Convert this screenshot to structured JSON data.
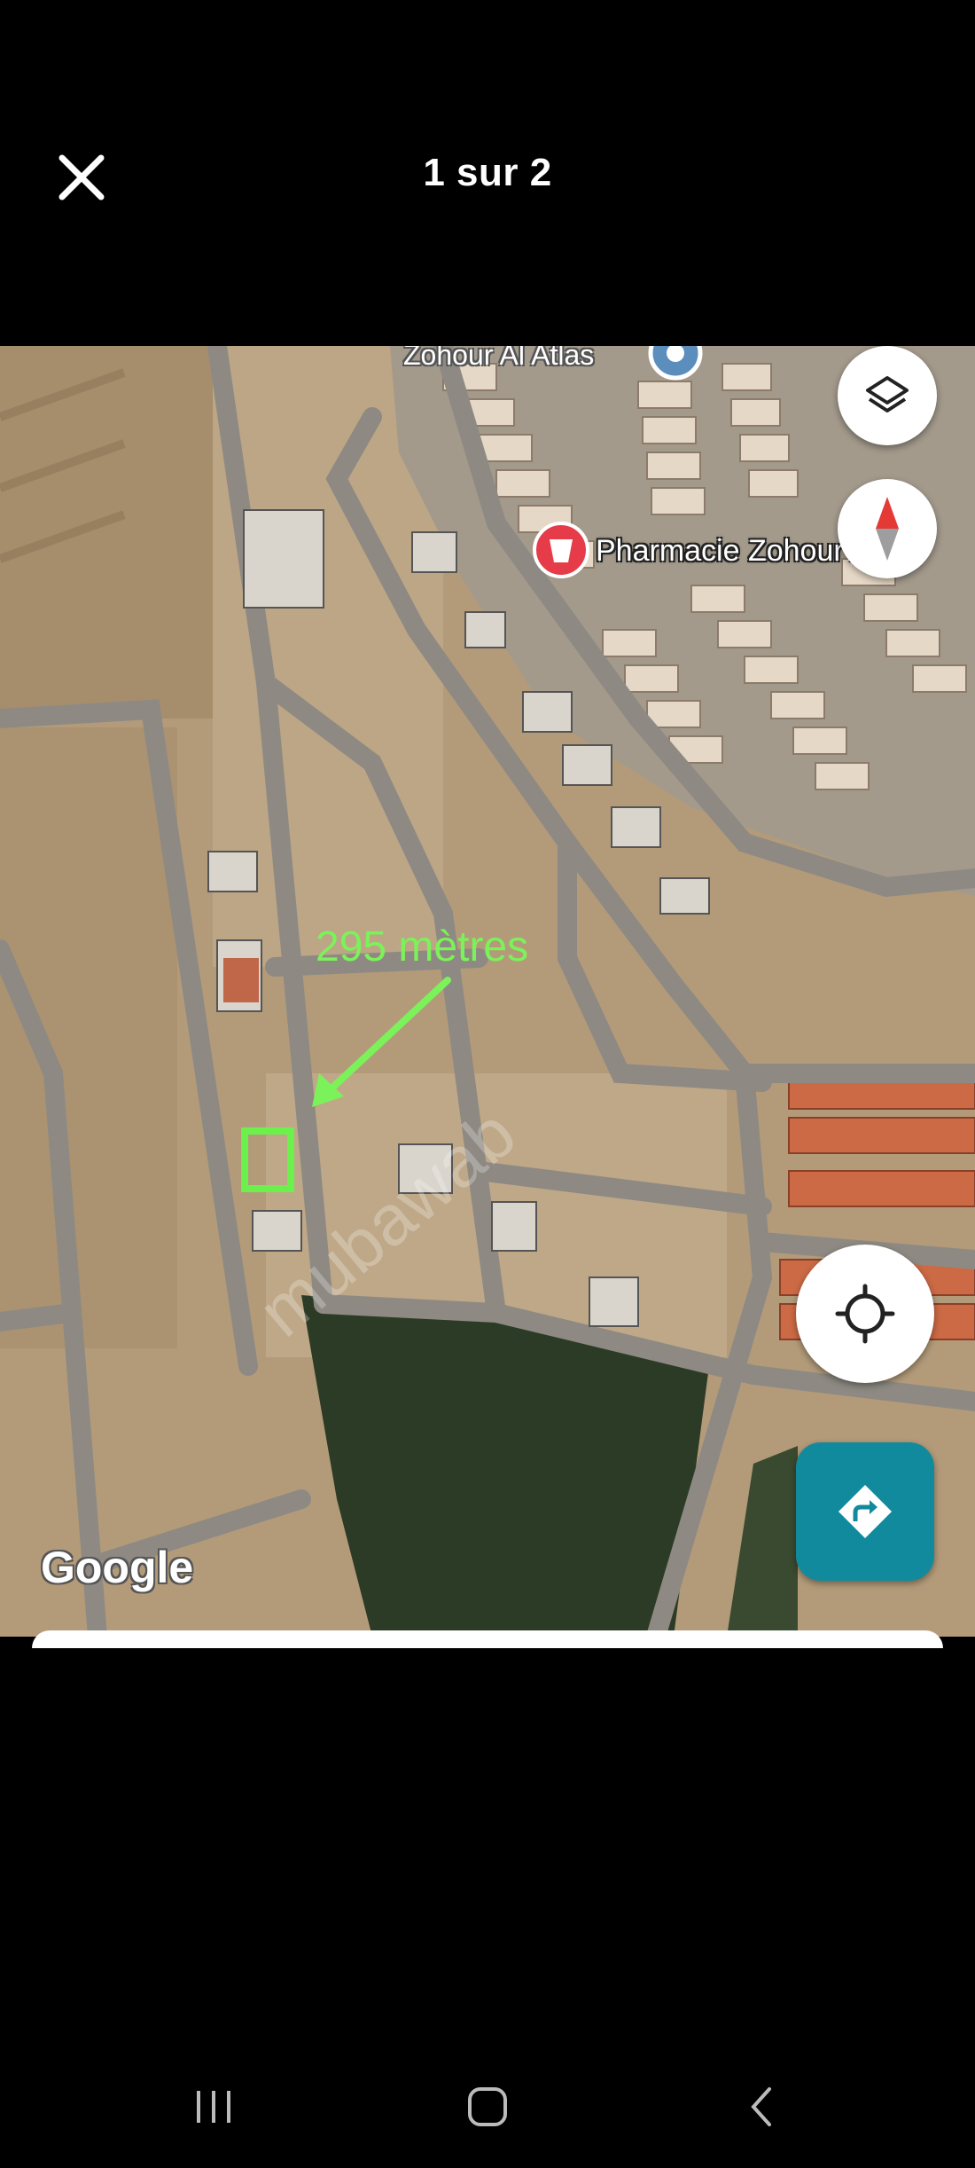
{
  "viewer": {
    "counter": "1 sur 2"
  },
  "map": {
    "place_label": "Zohour Al Atlas",
    "pharmacy_label": "Pharmacie Zohour Atlas",
    "distance_annotation": "295 mètres",
    "attribution": "Google",
    "watermark_text": "mubawab",
    "annotation_color": "#7cf25a",
    "directions_color": "#128a9e",
    "icons": {
      "layers": "layers-icon",
      "compass": "compass-icon",
      "my_location": "my-location-icon",
      "directions": "directions-icon",
      "pharmacy": "pharmacy-marker-icon",
      "place": "place-marker-icon"
    }
  },
  "system_nav": {
    "recents": "recent-apps-icon",
    "home": "home-icon",
    "back": "back-icon"
  }
}
